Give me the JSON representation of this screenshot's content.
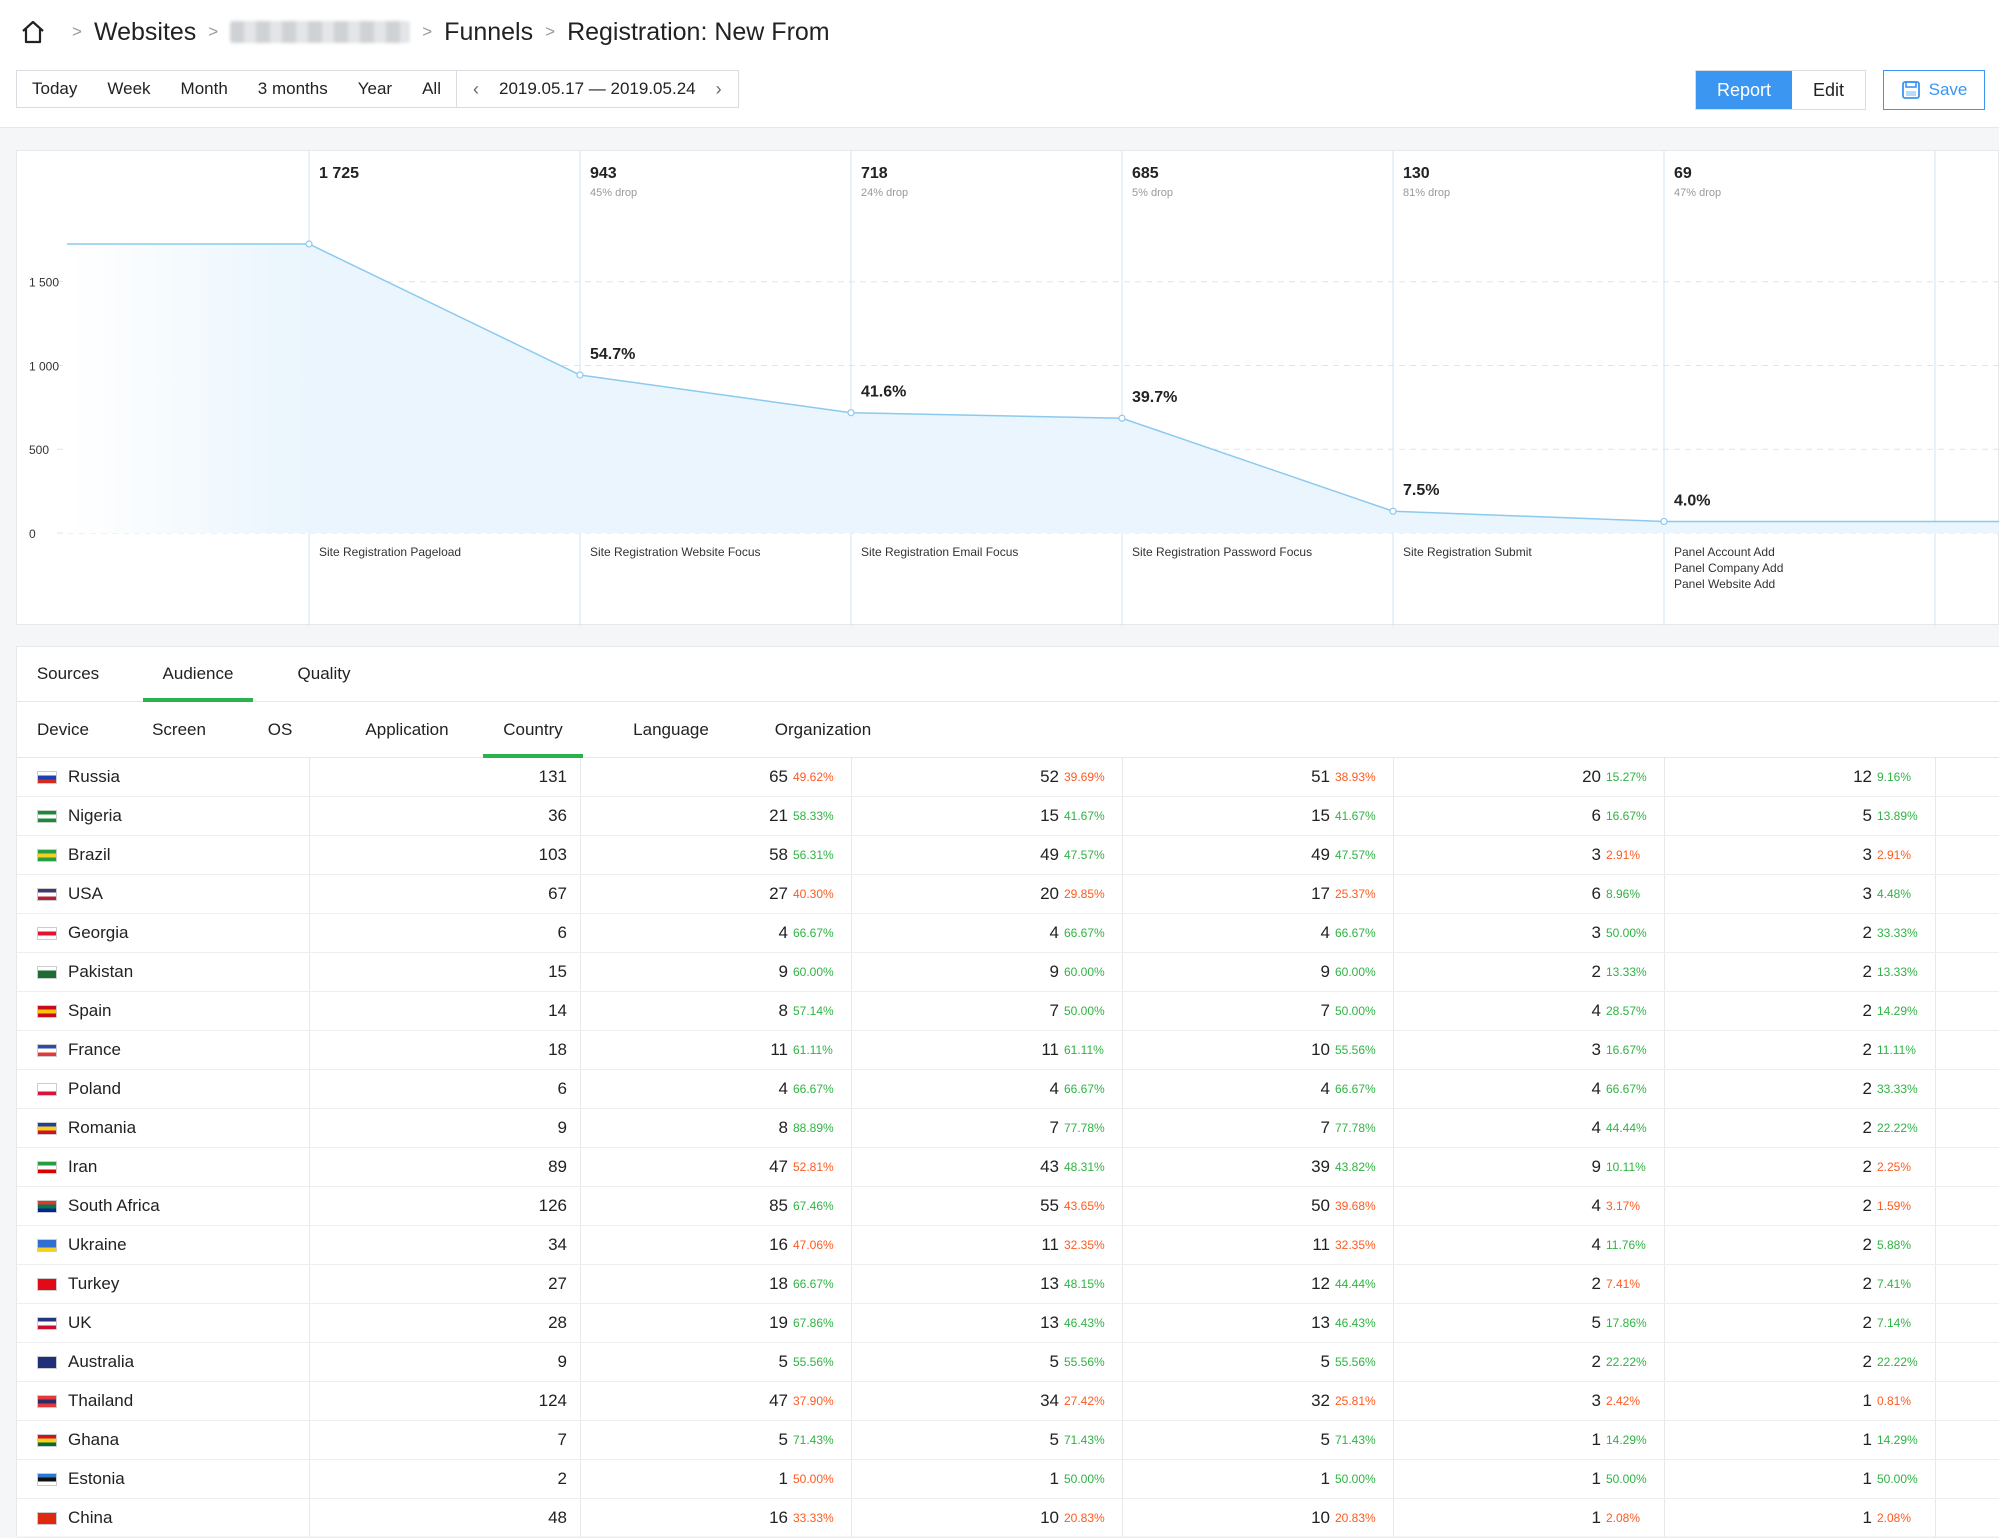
{
  "breadcrumb": {
    "home_icon": "home-icon",
    "items": [
      "Websites",
      "Funnels",
      "Registration: New From"
    ]
  },
  "range": {
    "buttons": [
      "Today",
      "Week",
      "Month",
      "3 months",
      "Year",
      "All"
    ],
    "date": "2019.05.17 — 2019.05.24"
  },
  "mode": {
    "report": "Report",
    "edit": "Edit",
    "save": "Save"
  },
  "colors": {
    "accent": "#3a96f0",
    "green": "#2fb344",
    "red": "#ff5a1f",
    "line": "#8cc9f0",
    "fill": "#eaf5fd"
  },
  "chart_data": {
    "type": "area",
    "y_ticks": [
      "1 500",
      "1 000",
      "500",
      "0"
    ],
    "y_tick_values": [
      1500,
      1000,
      500,
      0
    ],
    "ylim": [
      0,
      1725
    ],
    "steps": [
      {
        "count": "1 725",
        "value": 1725,
        "drop": "",
        "conversion": "",
        "labels": [
          "Site Registration Pageload"
        ]
      },
      {
        "count": "943",
        "value": 943,
        "drop": "45% drop",
        "conversion": "54.7%",
        "labels": [
          "Site Registration Website Focus"
        ]
      },
      {
        "count": "718",
        "value": 718,
        "drop": "24% drop",
        "conversion": "41.6%",
        "labels": [
          "Site Registration Email Focus"
        ]
      },
      {
        "count": "685",
        "value": 685,
        "drop": "5% drop",
        "conversion": "39.7%",
        "labels": [
          "Site Registration Password Focus"
        ]
      },
      {
        "count": "130",
        "value": 130,
        "drop": "81% drop",
        "conversion": "7.5%",
        "labels": [
          "Site Registration Submit"
        ]
      },
      {
        "count": "69",
        "value": 69,
        "drop": "47% drop",
        "conversion": "4.0%",
        "labels": [
          "Panel Account Add",
          "Panel Company Add",
          "Panel Website Add"
        ]
      }
    ]
  },
  "tabs": [
    "Sources",
    "Audience",
    "Quality"
  ],
  "active_tab": 1,
  "subtabs": [
    "Device",
    "Screen",
    "OS",
    "Application",
    "Country",
    "Language",
    "Organization"
  ],
  "active_subtab": 4,
  "rows": [
    {
      "country": "Russia",
      "flag": [
        "#ffffff",
        "#1c3fb4",
        "#d52b1e"
      ],
      "total": "131",
      "cells": [
        [
          "65",
          "49.62%",
          "red"
        ],
        [
          "52",
          "39.69%",
          "red"
        ],
        [
          "51",
          "38.93%",
          "red"
        ],
        [
          "20",
          "15.27%",
          "green"
        ],
        [
          "12",
          "9.16%",
          "green"
        ]
      ]
    },
    {
      "country": "Nigeria",
      "flag": [
        "#1d8a3a",
        "#ffffff",
        "#1d8a3a"
      ],
      "total": "36",
      "cells": [
        [
          "21",
          "58.33%",
          "green"
        ],
        [
          "15",
          "41.67%",
          "green"
        ],
        [
          "15",
          "41.67%",
          "green"
        ],
        [
          "6",
          "16.67%",
          "green"
        ],
        [
          "5",
          "13.89%",
          "green"
        ]
      ]
    },
    {
      "country": "Brazil",
      "flag": [
        "#2a9d3e",
        "#f2d024",
        "#2a9d3e"
      ],
      "total": "103",
      "cells": [
        [
          "58",
          "56.31%",
          "green"
        ],
        [
          "49",
          "47.57%",
          "green"
        ],
        [
          "49",
          "47.57%",
          "green"
        ],
        [
          "3",
          "2.91%",
          "red"
        ],
        [
          "3",
          "2.91%",
          "red"
        ]
      ]
    },
    {
      "country": "USA",
      "flag": [
        "#3c3b6e",
        "#ffffff",
        "#b22234"
      ],
      "total": "67",
      "cells": [
        [
          "27",
          "40.30%",
          "red"
        ],
        [
          "20",
          "29.85%",
          "red"
        ],
        [
          "17",
          "25.37%",
          "red"
        ],
        [
          "6",
          "8.96%",
          "green"
        ],
        [
          "3",
          "4.48%",
          "green"
        ]
      ]
    },
    {
      "country": "Georgia",
      "flag": [
        "#ffffff",
        "#e8112d",
        "#ffffff"
      ],
      "total": "6",
      "cells": [
        [
          "4",
          "66.67%",
          "green"
        ],
        [
          "4",
          "66.67%",
          "green"
        ],
        [
          "4",
          "66.67%",
          "green"
        ],
        [
          "3",
          "50.00%",
          "green"
        ],
        [
          "2",
          "33.33%",
          "green"
        ]
      ]
    },
    {
      "country": "Pakistan",
      "flag": [
        "#ffffff",
        "#1e6b33",
        "#1e6b33"
      ],
      "total": "15",
      "cells": [
        [
          "9",
          "60.00%",
          "green"
        ],
        [
          "9",
          "60.00%",
          "green"
        ],
        [
          "9",
          "60.00%",
          "green"
        ],
        [
          "2",
          "13.33%",
          "green"
        ],
        [
          "2",
          "13.33%",
          "green"
        ]
      ]
    },
    {
      "country": "Spain",
      "flag": [
        "#c60b1e",
        "#ffc400",
        "#c60b1e"
      ],
      "total": "14",
      "cells": [
        [
          "8",
          "57.14%",
          "green"
        ],
        [
          "7",
          "50.00%",
          "green"
        ],
        [
          "7",
          "50.00%",
          "green"
        ],
        [
          "4",
          "28.57%",
          "green"
        ],
        [
          "2",
          "14.29%",
          "green"
        ]
      ]
    },
    {
      "country": "France",
      "flag": [
        "#2a4ea8",
        "#ffffff",
        "#e23a3a"
      ],
      "total": "18",
      "cells": [
        [
          "11",
          "61.11%",
          "green"
        ],
        [
          "11",
          "61.11%",
          "green"
        ],
        [
          "10",
          "55.56%",
          "green"
        ],
        [
          "3",
          "16.67%",
          "green"
        ],
        [
          "2",
          "11.11%",
          "green"
        ]
      ]
    },
    {
      "country": "Poland",
      "flag": [
        "#ffffff",
        "#ffffff",
        "#dc143c"
      ],
      "total": "6",
      "cells": [
        [
          "4",
          "66.67%",
          "green"
        ],
        [
          "4",
          "66.67%",
          "green"
        ],
        [
          "4",
          "66.67%",
          "green"
        ],
        [
          "4",
          "66.67%",
          "green"
        ],
        [
          "2",
          "33.33%",
          "green"
        ]
      ]
    },
    {
      "country": "Romania",
      "flag": [
        "#1b3fa3",
        "#fcd116",
        "#ce1126"
      ],
      "total": "9",
      "cells": [
        [
          "8",
          "88.89%",
          "green"
        ],
        [
          "7",
          "77.78%",
          "green"
        ],
        [
          "7",
          "77.78%",
          "green"
        ],
        [
          "4",
          "44.44%",
          "green"
        ],
        [
          "2",
          "22.22%",
          "green"
        ]
      ]
    },
    {
      "country": "Iran",
      "flag": [
        "#239f40",
        "#ffffff",
        "#da0000"
      ],
      "total": "89",
      "cells": [
        [
          "47",
          "52.81%",
          "red"
        ],
        [
          "43",
          "48.31%",
          "green"
        ],
        [
          "39",
          "43.82%",
          "green"
        ],
        [
          "9",
          "10.11%",
          "green"
        ],
        [
          "2",
          "2.25%",
          "red"
        ]
      ]
    },
    {
      "country": "South Africa",
      "flag": [
        "#de3831",
        "#007a4d",
        "#002395"
      ],
      "total": "126",
      "cells": [
        [
          "85",
          "67.46%",
          "green"
        ],
        [
          "55",
          "43.65%",
          "red"
        ],
        [
          "50",
          "39.68%",
          "red"
        ],
        [
          "4",
          "3.17%",
          "red"
        ],
        [
          "2",
          "1.59%",
          "red"
        ]
      ]
    },
    {
      "country": "Ukraine",
      "flag": [
        "#2f6fd1",
        "#2f6fd1",
        "#f5d020"
      ],
      "total": "34",
      "cells": [
        [
          "16",
          "47.06%",
          "red"
        ],
        [
          "11",
          "32.35%",
          "red"
        ],
        [
          "11",
          "32.35%",
          "red"
        ],
        [
          "4",
          "11.76%",
          "green"
        ],
        [
          "2",
          "5.88%",
          "green"
        ]
      ]
    },
    {
      "country": "Turkey",
      "flag": [
        "#e30a17",
        "#e30a17",
        "#e30a17"
      ],
      "total": "27",
      "cells": [
        [
          "18",
          "66.67%",
          "green"
        ],
        [
          "13",
          "48.15%",
          "green"
        ],
        [
          "12",
          "44.44%",
          "green"
        ],
        [
          "2",
          "7.41%",
          "red"
        ],
        [
          "2",
          "7.41%",
          "green"
        ]
      ]
    },
    {
      "country": "UK",
      "flag": [
        "#23377d",
        "#ffffff",
        "#c8102e"
      ],
      "total": "28",
      "cells": [
        [
          "19",
          "67.86%",
          "green"
        ],
        [
          "13",
          "46.43%",
          "green"
        ],
        [
          "13",
          "46.43%",
          "green"
        ],
        [
          "5",
          "17.86%",
          "green"
        ],
        [
          "2",
          "7.14%",
          "green"
        ]
      ]
    },
    {
      "country": "Australia",
      "flag": [
        "#1f2f7a",
        "#1f2f7a",
        "#1f2f7a"
      ],
      "total": "9",
      "cells": [
        [
          "5",
          "55.56%",
          "green"
        ],
        [
          "5",
          "55.56%",
          "green"
        ],
        [
          "5",
          "55.56%",
          "green"
        ],
        [
          "2",
          "22.22%",
          "green"
        ],
        [
          "2",
          "22.22%",
          "green"
        ]
      ]
    },
    {
      "country": "Thailand",
      "flag": [
        "#e23a3a",
        "#2d2a6b",
        "#e23a3a"
      ],
      "total": "124",
      "cells": [
        [
          "47",
          "37.90%",
          "red"
        ],
        [
          "34",
          "27.42%",
          "red"
        ],
        [
          "32",
          "25.81%",
          "red"
        ],
        [
          "3",
          "2.42%",
          "red"
        ],
        [
          "1",
          "0.81%",
          "red"
        ]
      ]
    },
    {
      "country": "Ghana",
      "flag": [
        "#ce1126",
        "#fcd116",
        "#006b3f"
      ],
      "total": "7",
      "cells": [
        [
          "5",
          "71.43%",
          "green"
        ],
        [
          "5",
          "71.43%",
          "green"
        ],
        [
          "5",
          "71.43%",
          "green"
        ],
        [
          "1",
          "14.29%",
          "green"
        ],
        [
          "1",
          "14.29%",
          "green"
        ]
      ]
    },
    {
      "country": "Estonia",
      "flag": [
        "#2b7ad0",
        "#111111",
        "#ffffff"
      ],
      "total": "2",
      "cells": [
        [
          "1",
          "50.00%",
          "red"
        ],
        [
          "1",
          "50.00%",
          "green"
        ],
        [
          "1",
          "50.00%",
          "green"
        ],
        [
          "1",
          "50.00%",
          "green"
        ],
        [
          "1",
          "50.00%",
          "green"
        ]
      ]
    },
    {
      "country": "China",
      "flag": [
        "#de2910",
        "#de2910",
        "#de2910"
      ],
      "total": "48",
      "cells": [
        [
          "16",
          "33.33%",
          "red"
        ],
        [
          "10",
          "20.83%",
          "red"
        ],
        [
          "10",
          "20.83%",
          "red"
        ],
        [
          "1",
          "2.08%",
          "red"
        ],
        [
          "1",
          "2.08%",
          "red"
        ]
      ]
    }
  ]
}
